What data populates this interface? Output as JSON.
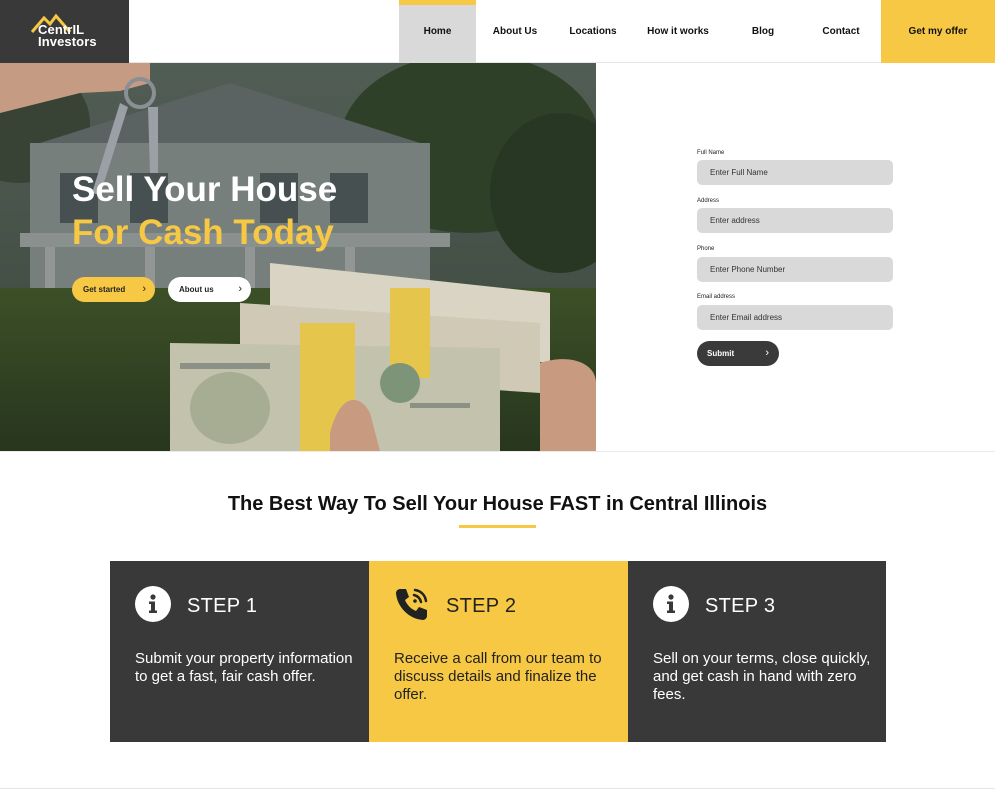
{
  "brand": {
    "name_line1": "CentrIL",
    "name_line2": "Investors"
  },
  "nav": {
    "home": "Home",
    "about": "About Us",
    "locations": "Locations",
    "how": "How it works",
    "blog": "Blog",
    "contact": "Contact",
    "offer": "Get my offer"
  },
  "hero": {
    "title_line1": "Sell Your House",
    "title_line2": "For Cash Today",
    "btn_start": "Get started",
    "btn_about": "About us"
  },
  "form": {
    "name_label": "Full Name",
    "name_placeholder": "Enter Full Name",
    "address_label": "Address",
    "address_placeholder": "Enter address",
    "phone_label": "Phone",
    "phone_placeholder": "Enter Phone Number",
    "email_label": "Email address",
    "email_placeholder": "Enter Email address",
    "submit": "Submit"
  },
  "section": {
    "title": "The Best Way To Sell Your House FAST in Central Illinois"
  },
  "steps": [
    {
      "title": "STEP 1",
      "text": "Submit your property information to get a fast, fair cash offer.",
      "icon": "info-icon"
    },
    {
      "title": "STEP 2",
      "text": "Receive a call from our team to discuss details and finalize the offer.",
      "icon": "phone-call-icon"
    },
    {
      "title": "STEP 3",
      "text": "Sell on your terms, close quickly, and get cash in hand with zero fees.",
      "icon": "info-icon"
    }
  ],
  "colors": {
    "accent": "#f7c843",
    "dark": "#393939",
    "input": "#d9d9d9"
  }
}
